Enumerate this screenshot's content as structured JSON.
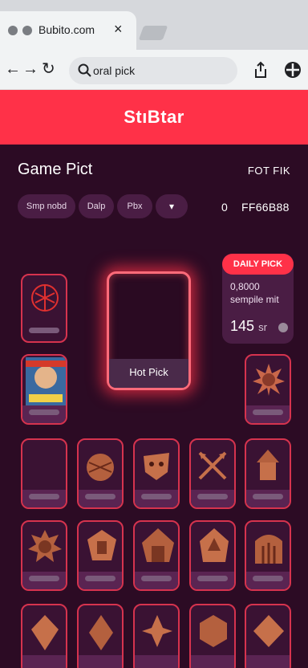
{
  "browser": {
    "tab_title": "Bubito.com",
    "tab_close": "×",
    "address": "oral pick"
  },
  "app": {
    "brand": "StıBtar",
    "page_title": "Game Pict",
    "top_right_label": "FOT FIK"
  },
  "filters": {
    "chips": [
      "Smp nobd",
      "Dalp",
      "Pbx"
    ],
    "dropdown_glyph": "▾",
    "count": "0",
    "code": "FF66B88"
  },
  "featured": {
    "hot_label": "Hot Pick"
  },
  "daily": {
    "badge": "DAILY PICK",
    "line1": "0,8000",
    "line2": "sempile mit",
    "value": "145",
    "unit": "sr"
  },
  "colors": {
    "accent": "#ff3148",
    "background": "#2c0b24",
    "card_border": "#d6334e"
  },
  "tile_icons": [
    "crest-icon",
    "game-cover-icon",
    "sun-emblem-icon",
    "empty-tile",
    "shield-orb-icon",
    "mask-icon",
    "crossed-arrows-icon",
    "tower-icon",
    "lion-icon",
    "totem-icon",
    "fortress-icon",
    "castle-icon",
    "gate-icon",
    "gem-icon",
    "crystal-icon",
    "star-gem-icon",
    "hex-gem-icon",
    "diamond-icon"
  ]
}
